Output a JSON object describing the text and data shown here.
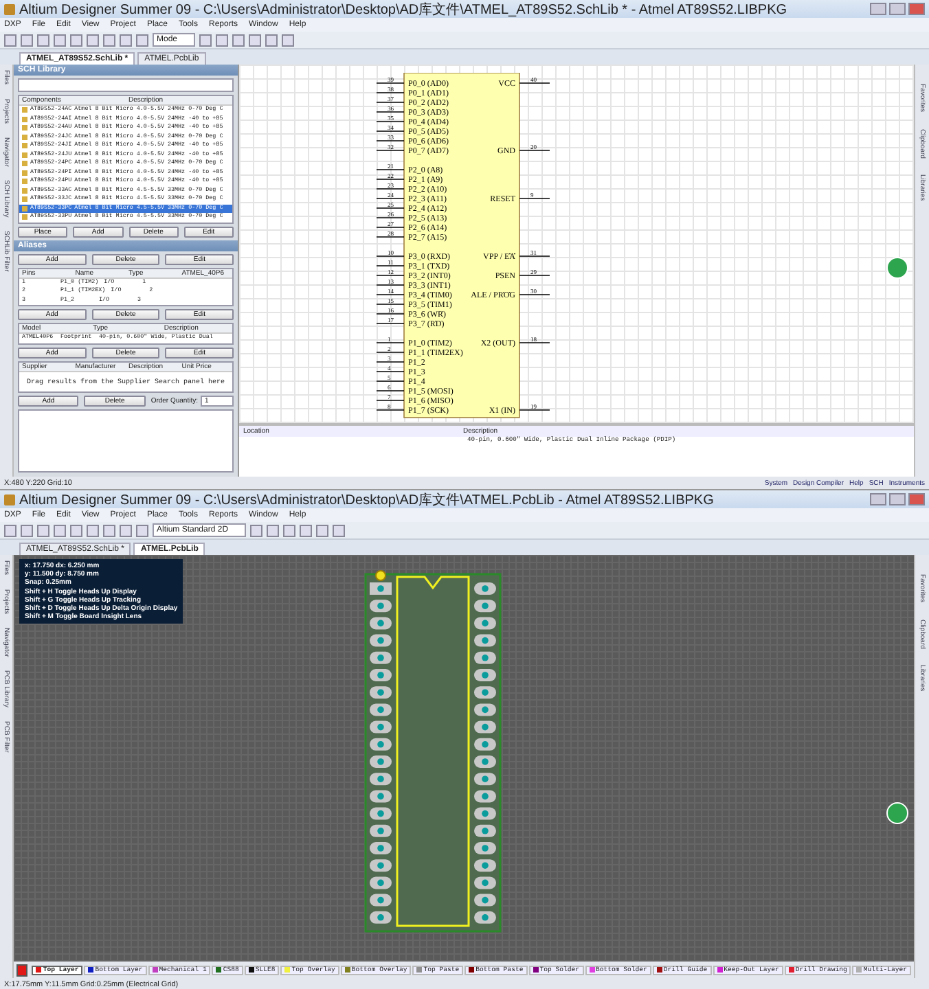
{
  "schematic_window": {
    "title": "Altium Designer Summer 09 - C:\\Users\\Administrator\\Desktop\\AD库文件\\ATMEL_AT89S52.SchLib * - Atmel AT89S52.LIBPKG",
    "menu": [
      "DXP",
      "File",
      "Edit",
      "View",
      "Project",
      "Place",
      "Tools",
      "Reports",
      "Window",
      "Help"
    ],
    "toolbar_dropdown": "Mode",
    "doc_tabs": [
      {
        "label": "ATMEL_AT89S52.SchLib *",
        "selected": true
      },
      {
        "label": "ATMEL.PcbLib",
        "selected": false
      }
    ],
    "side_tabs": [
      "Files",
      "Projects",
      "Navigator",
      "SCH Library",
      "SCHLib Filter"
    ],
    "right_tabs": [
      "Favorites",
      "Clipboard",
      "Libraries"
    ],
    "library_panel": {
      "title": "SCH Library",
      "component_columns": [
        "Components",
        "Description"
      ],
      "components": [
        {
          "name": "AT89S52-24AC",
          "description": "Atmel 8 Bit Micro 4.0-5.5V 24MHz 0-70 Deg C",
          "selected": false
        },
        {
          "name": "AT89S52-24AI",
          "description": "Atmel 8 Bit Micro 4.0-5.5V 24MHz -40 to +85",
          "selected": false
        },
        {
          "name": "AT89S52-24AU",
          "description": "Atmel 8 Bit Micro 4.0-5.5V 24MHz -40 to +85",
          "selected": false
        },
        {
          "name": "AT89S52-24JC",
          "description": "Atmel 8 Bit Micro 4.0-5.5V 24MHz 0-70 Deg C",
          "selected": false
        },
        {
          "name": "AT89S52-24JI",
          "description": "Atmel 8 Bit Micro 4.0-5.5V 24MHz -40 to +85",
          "selected": false
        },
        {
          "name": "AT89S52-24JU",
          "description": "Atmel 8 Bit Micro 4.0-5.5V 24MHz -40 to +85",
          "selected": false
        },
        {
          "name": "AT89S52-24PC",
          "description": "Atmel 8 Bit Micro 4.0-5.5V 24MHz 0-70 Deg C",
          "selected": false
        },
        {
          "name": "AT89S52-24PI",
          "description": "Atmel 8 Bit Micro 4.0-5.5V 24MHz -40 to +85",
          "selected": false
        },
        {
          "name": "AT89S52-24PU",
          "description": "Atmel 8 Bit Micro 4.0-5.5V 24MHz -40 to +85",
          "selected": false
        },
        {
          "name": "AT89S52-33AC",
          "description": "Atmel 8 Bit Micro 4.5-5.5V 33MHz 0-70 Deg C",
          "selected": false
        },
        {
          "name": "AT89S52-33JC",
          "description": "Atmel 8 Bit Micro 4.5-5.5V 33MHz 0-70 Deg C",
          "selected": false
        },
        {
          "name": "AT89S52-33PC",
          "description": "Atmel 8 Bit Micro 4.5-5.5V 33MHz 0-70 Deg C",
          "selected": true
        },
        {
          "name": "AT89S52-33PU",
          "description": "Atmel 8 Bit Micro 4.5-5.5V 33MHz 0-70 Deg C",
          "selected": false
        }
      ],
      "component_buttons": [
        "Place",
        "Add",
        "Delete",
        "Edit"
      ],
      "aliases_label": "Aliases",
      "alias_buttons": [
        "Add",
        "Delete",
        "Edit"
      ],
      "pin_columns": [
        "Pins",
        "Name",
        "Type",
        "ATMEL_40P6"
      ],
      "pins": [
        [
          "1",
          "P1_0 (TIM2)",
          "I/O",
          "1"
        ],
        [
          "2",
          "P1_1 (TIM2EX)",
          "I/O",
          "2"
        ],
        [
          "3",
          "P1_2",
          "I/O",
          "3"
        ]
      ],
      "pin_buttons": [
        "Add",
        "Delete",
        "Edit"
      ],
      "model_columns": [
        "Model",
        "Type",
        "Description"
      ],
      "models": [
        [
          "ATMEL40P6",
          "Footprint",
          "40-pin, 0.600\" Wide, Plastic Dual"
        ]
      ],
      "model_buttons": [
        "Add",
        "Delete",
        "Edit"
      ],
      "supplier_columns": [
        "Supplier",
        "Manufacturer",
        "Description",
        "Unit Price"
      ],
      "supplier_hint": "Drag results from the Supplier Search panel here",
      "supplier_buttons": [
        "Add",
        "Delete"
      ],
      "order_label": "Order Quantity:",
      "order_quantity": "1"
    },
    "symbol": {
      "rows": [
        {
          "pin": {
            "number": "39",
            "label": "P0_0 (AD0)"
          },
          "right": {
            "number": "40",
            "label": "VCC"
          }
        },
        {
          "pin": {
            "number": "38",
            "label": "P0_1 (AD1)"
          }
        },
        {
          "pin": {
            "number": "37",
            "label": "P0_2 (AD2)"
          }
        },
        {
          "pin": {
            "number": "36",
            "label": "P0_3 (AD3)"
          }
        },
        {
          "pin": {
            "number": "35",
            "label": "P0_4 (AD4)"
          }
        },
        {
          "pin": {
            "number": "34",
            "label": "P0_5 (AD5)"
          }
        },
        {
          "pin": {
            "number": "33",
            "label": "P0_6 (AD6)"
          }
        },
        {
          "pin": {
            "number": "32",
            "label": "P0_7 (AD7)"
          },
          "right": {
            "number": "20",
            "label": "GND"
          }
        },
        {},
        {
          "pin": {
            "number": "21",
            "label": "P2_0 (A8)"
          }
        },
        {
          "pin": {
            "number": "22",
            "label": "P2_1 (A9)"
          }
        },
        {
          "pin": {
            "number": "23",
            "label": "P2_2 (A10)"
          }
        },
        {
          "pin": {
            "number": "24",
            "label": "P2_3 (A11)"
          },
          "right": {
            "number": "9",
            "label": "RESET"
          }
        },
        {
          "pin": {
            "number": "25",
            "label": "P2_4 (A12)"
          }
        },
        {
          "pin": {
            "number": "26",
            "label": "P2_5 (A13)"
          }
        },
        {
          "pin": {
            "number": "27",
            "label": "P2_6 (A14)"
          }
        },
        {
          "pin": {
            "number": "28",
            "label": "P2_7 (A15)"
          }
        },
        {},
        {
          "pin": {
            "number": "10",
            "label": "P3_0 (RXD)"
          },
          "right": {
            "number": "31",
            "label": "VPP / ",
            "overbar": "EA"
          }
        },
        {
          "pin": {
            "number": "11",
            "label": "P3_1 (TXD)"
          }
        },
        {
          "pin": {
            "number": "12",
            "label": "P3_2 (INT0)"
          },
          "right": {
            "number": "29",
            "label": "PSEN"
          }
        },
        {
          "pin": {
            "number": "13",
            "label": "P3_3 (INT1)"
          }
        },
        {
          "pin": {
            "number": "14",
            "label": "P3_4 (TIM0)"
          },
          "right": {
            "number": "30",
            "label": "ALE / ",
            "overbar": "PROG"
          }
        },
        {
          "pin": {
            "number": "15",
            "label": "P3_5 (TIM1)"
          }
        },
        {
          "pin": {
            "number": "16",
            "label": "P3_6 (",
            "overbar": "WR",
            "suffix": ")"
          }
        },
        {
          "pin": {
            "number": "17",
            "label": "P3_7 (",
            "overbar": "RD",
            "suffix": ")"
          }
        },
        {},
        {
          "pin": {
            "number": "1",
            "label": "P1_0 (TIM2)"
          },
          "right": {
            "number": "18",
            "label": "X2 (OUT)"
          }
        },
        {
          "pin": {
            "number": "2",
            "label": "P1_1 (TIM2EX)"
          }
        },
        {
          "pin": {
            "number": "3",
            "label": "P1_2"
          }
        },
        {
          "pin": {
            "number": "4",
            "label": "P1_3"
          }
        },
        {
          "pin": {
            "number": "5",
            "label": "P1_4"
          }
        },
        {
          "pin": {
            "number": "6",
            "label": "P1_5 (MOSI)"
          }
        },
        {
          "pin": {
            "number": "7",
            "label": "P1_6 (MISO)"
          }
        },
        {
          "pin": {
            "number": "8",
            "label": "P1_7 (SCK)"
          },
          "right": {
            "number": "19",
            "label": "X1 (IN)"
          }
        }
      ]
    },
    "messages": {
      "columns": [
        "Location",
        "Description"
      ],
      "description": "40-pin, 0.600\" Wide, Plastic Dual Inline Package (PDIP)"
    },
    "status_bar": "X:480 Y:220   Grid:10",
    "bottom_tabs": [
      "System",
      "Design Compiler",
      "Help",
      "SCH",
      "Instruments"
    ]
  },
  "pcb_window": {
    "title": "Altium Designer Summer 09 - C:\\Users\\Administrator\\Desktop\\AD库文件\\ATMEL.PcbLib - Atmel AT89S52.LIBPKG",
    "menu": [
      "DXP",
      "File",
      "Edit",
      "View",
      "Project",
      "Place",
      "Tools",
      "Reports",
      "Window",
      "Help"
    ],
    "view_dropdown": "Altium Standard 2D",
    "doc_tabs": [
      {
        "label": "ATMEL_AT89S52.SchLib *",
        "selected": false
      },
      {
        "label": "ATMEL.PcbLib",
        "selected": true
      }
    ],
    "side_tabs": [
      "Files",
      "Projects",
      "Navigator",
      "PCB Library",
      "PCB Filter"
    ],
    "right_tabs": [
      "Favorites",
      "Clipboard",
      "Libraries"
    ],
    "heads_up": [
      "x: 17.750   dx: 6.250 mm",
      "y: 11.500   dy: 8.750 mm",
      "Snap: 0.25mm",
      "Shift + H   Toggle Heads Up Display",
      "Shift + G   Toggle Heads Up Tracking",
      "Shift + D   Toggle Heads Up Delta Origin Display",
      "Shift + M   Toggle Board Insight Lens"
    ],
    "layers": [
      {
        "label": "Top Layer",
        "color": "#e01818",
        "selected": true
      },
      {
        "label": "Bottom Layer",
        "color": "#1020c0",
        "selected": false
      },
      {
        "label": "Mechanical 1",
        "color": "#c040c0",
        "selected": false
      },
      {
        "label": "CS88",
        "color": "#207020",
        "selected": false
      },
      {
        "label": "SLLE8",
        "color": "#101010",
        "selected": false
      },
      {
        "label": "Top Overlay",
        "color": "#f0f040",
        "selected": false
      },
      {
        "label": "Bottom Overlay",
        "color": "#808020",
        "selected": false
      },
      {
        "label": "Top Paste",
        "color": "#909090",
        "selected": false
      },
      {
        "label": "Bottom Paste",
        "color": "#800000",
        "selected": false
      },
      {
        "label": "Top Solder",
        "color": "#800080",
        "selected": false
      },
      {
        "label": "Bottom Solder",
        "color": "#e040e0",
        "selected": false
      },
      {
        "label": "Drill Guide",
        "color": "#a01010",
        "selected": false
      },
      {
        "label": "Keep-Out Layer",
        "color": "#d020d0",
        "selected": false
      },
      {
        "label": "Drill Drawing",
        "color": "#e02030",
        "selected": false
      },
      {
        "label": "Multi-Layer",
        "color": "#b0b0b0",
        "selected": false
      }
    ],
    "status_bar": "X:17.75mm Y:11.5mm   Grid:0.25mm   (Electrical Grid)"
  }
}
